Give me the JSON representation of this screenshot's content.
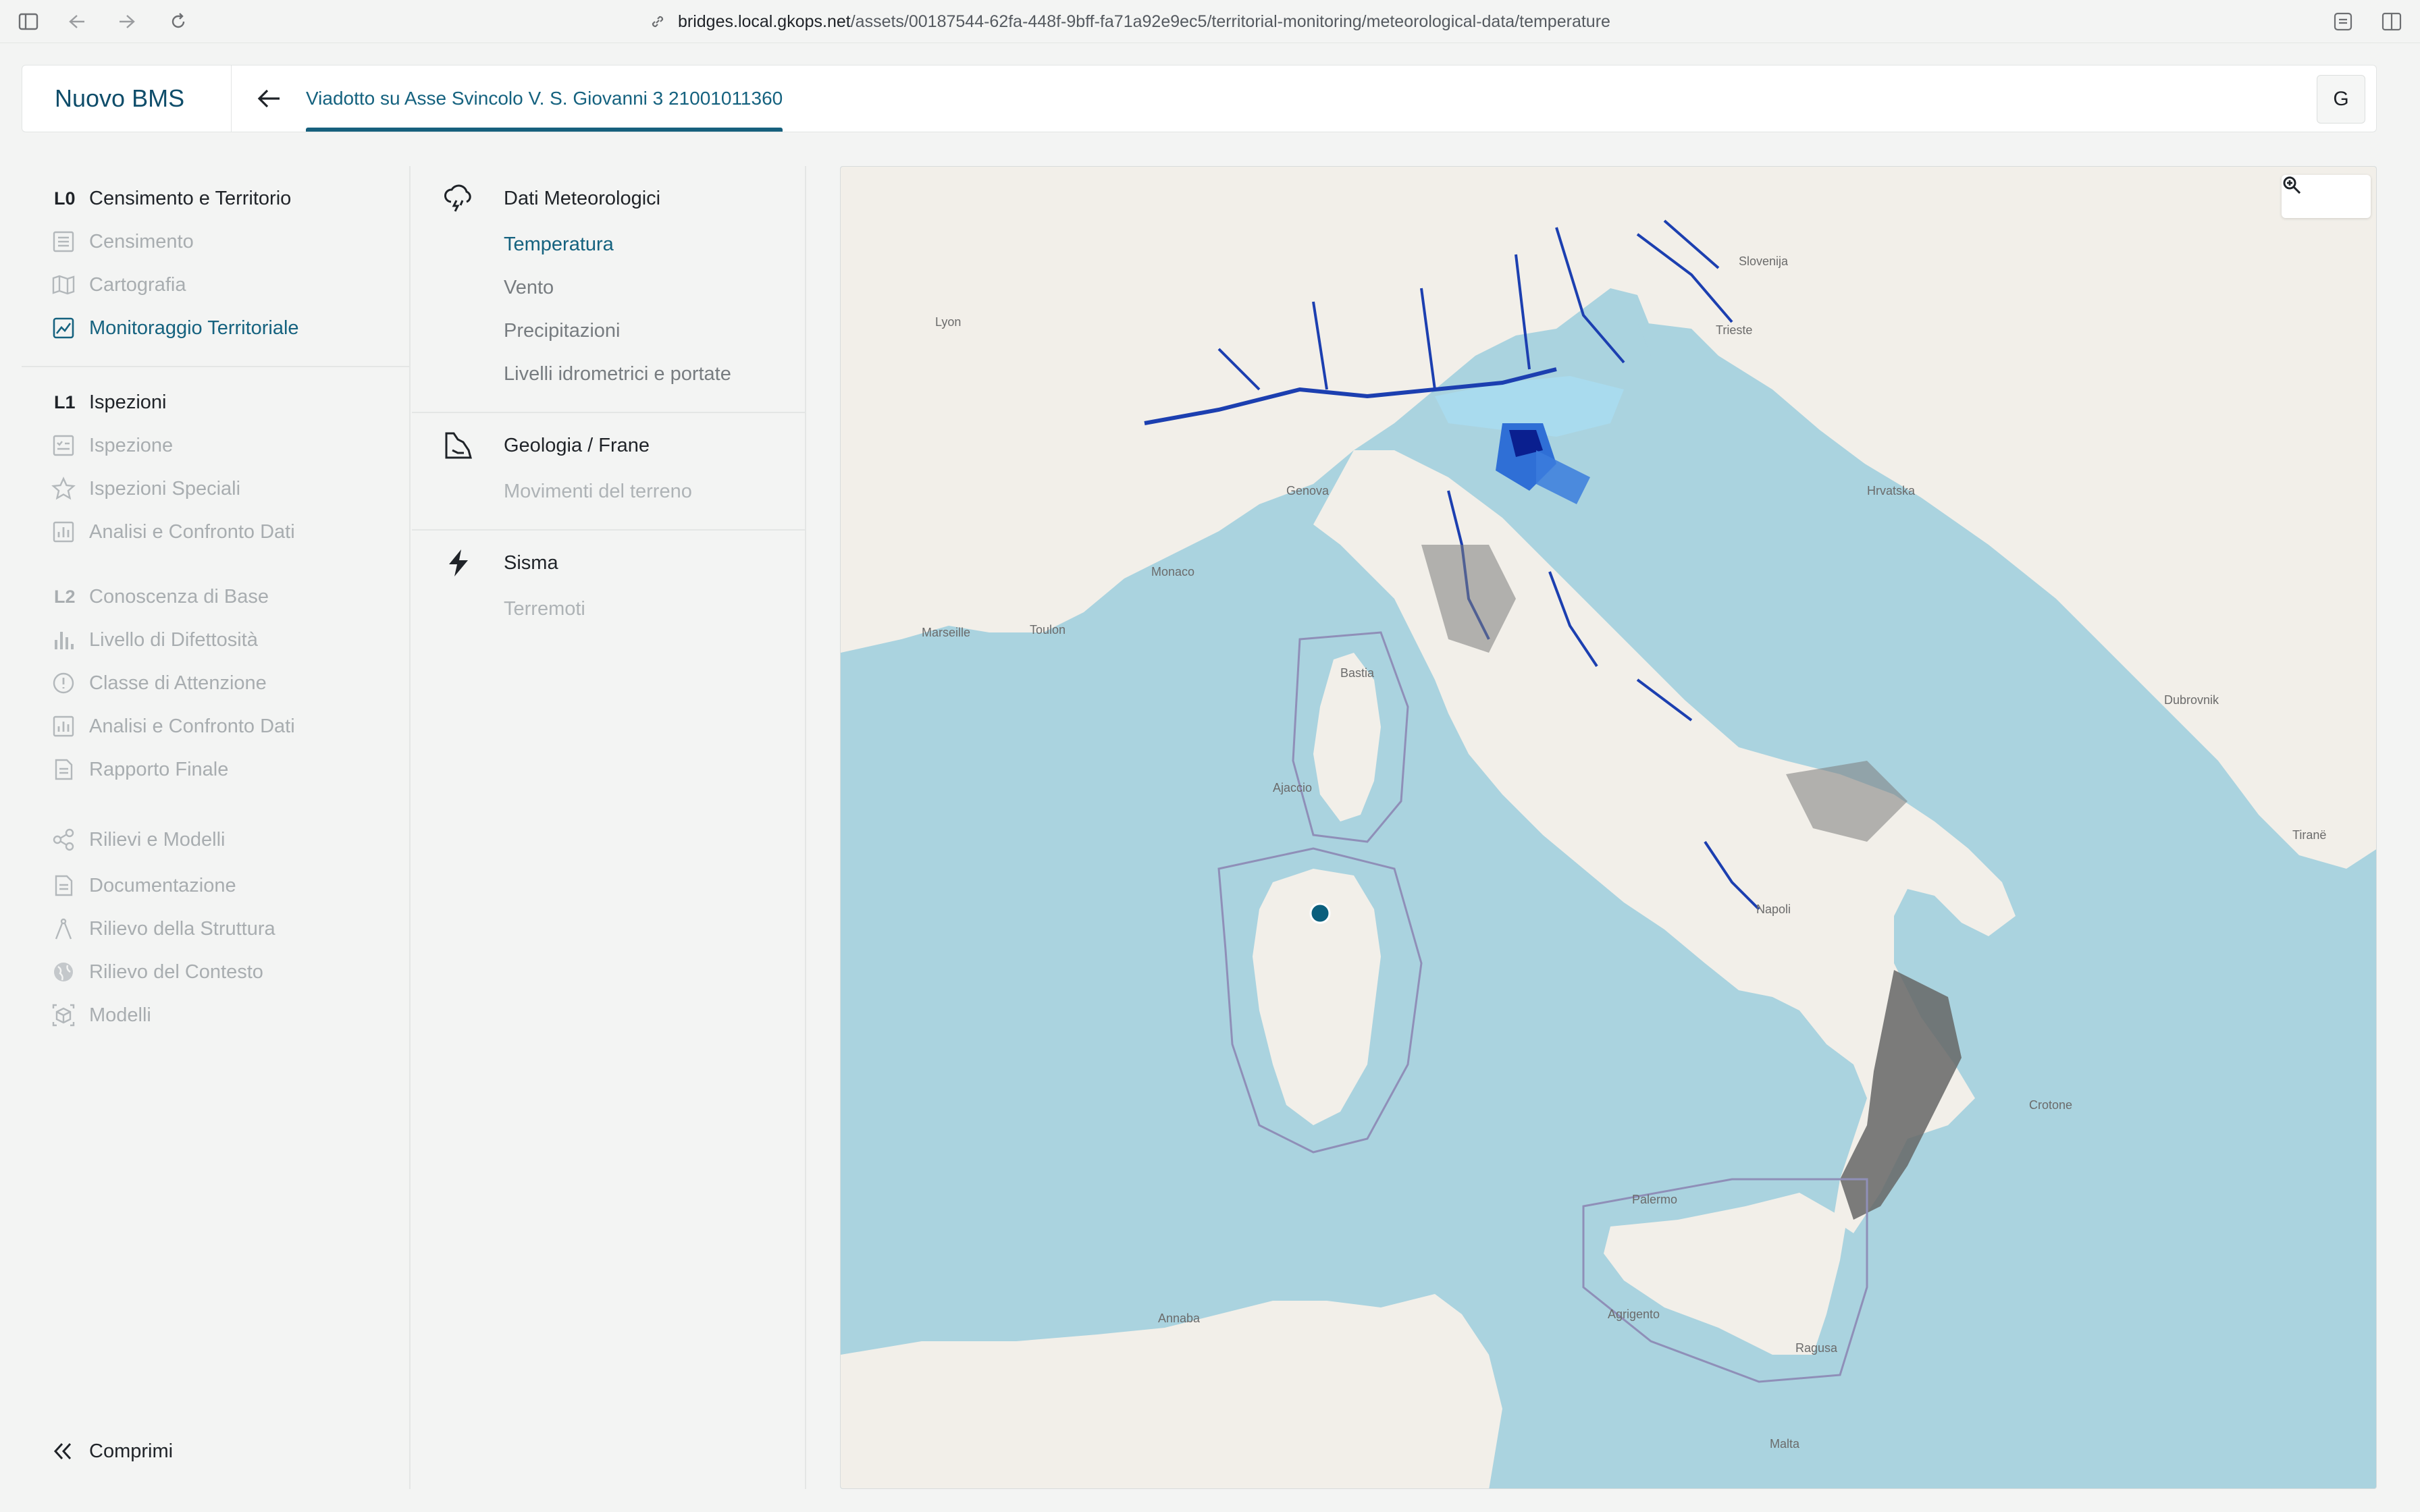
{
  "browser": {
    "url_host": "bridges.local.gkops.net",
    "url_path": "/assets/00187544-62fa-448f-9bff-fa71a92e9ec5/territorial-monitoring/meteorological-data/temperature"
  },
  "header": {
    "brand": "Nuovo BMS",
    "asset_title": "Viadotto su Asse Svincolo V. S. Giovanni 3 21001011360",
    "avatar_initial": "G"
  },
  "sidebar": {
    "sections": [
      {
        "level": "L0",
        "title": "Censimento e Territorio",
        "items": [
          {
            "label": "Censimento",
            "icon": "list-icon"
          },
          {
            "label": "Cartografia",
            "icon": "map-icon"
          },
          {
            "label": "Monitoraggio Territoriale",
            "icon": "chart-icon"
          }
        ]
      },
      {
        "level": "L1",
        "title": "Ispezioni",
        "items": [
          {
            "label": "Ispezione",
            "icon": "checklist-icon"
          },
          {
            "label": "Ispezioni Speciali",
            "icon": "star-icon"
          },
          {
            "label": "Analisi e Confronto Dati",
            "icon": "bar-chart-icon"
          }
        ]
      },
      {
        "level": "L2",
        "title": "Conoscenza di Base",
        "items": [
          {
            "label": "Livello di Difettosità",
            "icon": "bars-icon"
          },
          {
            "label": "Classe di Attenzione",
            "icon": "info-icon"
          },
          {
            "label": "Analisi e Confronto Dati",
            "icon": "bar-chart-icon"
          },
          {
            "label": "Rapporto Finale",
            "icon": "document-icon"
          }
        ]
      }
    ],
    "extra_items": [
      {
        "label": "Rilievi e Modelli",
        "icon": "share-icon"
      },
      {
        "label": "Documentazione",
        "icon": "document-icon"
      },
      {
        "label": "Rilievo della Struttura",
        "icon": "compass-icon"
      },
      {
        "label": "Rilievo del Contesto",
        "icon": "globe-icon"
      },
      {
        "label": "Modelli",
        "icon": "cube-icon"
      }
    ],
    "collapse_label": "Comprimi"
  },
  "subnav": {
    "groups": [
      {
        "title": "Dati Meteorologici",
        "icon": "storm-cloud-icon",
        "items": [
          "Temperatura",
          "Vento",
          "Precipitazioni",
          "Livelli idrometrici e portate"
        ]
      },
      {
        "title": "Geologia / Frane",
        "icon": "landslide-icon",
        "items": [
          "Movimenti del terreno"
        ]
      },
      {
        "title": "Sisma",
        "icon": "lightning-icon",
        "items": [
          "Terremoti"
        ]
      }
    ]
  },
  "map": {
    "labels": {
      "monaco": "Monaco",
      "genova": "Genova",
      "napoli": "Napoli",
      "palermo": "Palermo",
      "malta": "Malta",
      "bastia": "Bastia",
      "ajaccio": "Ajaccio",
      "crotone": "Crotone",
      "hrvatska": "Hrvatska",
      "slovenija": "Slovenija",
      "tirane": "Tiranë",
      "dubrovnik": "Dubrovnik",
      "marseille": "Marseille",
      "toulon": "Toulon",
      "lyon": "Lyon",
      "trieste": "Trieste",
      "ragusa": "Ragusa",
      "agrigento": "Agrigento",
      "annaba": "Annaba"
    },
    "colors": {
      "sea": "#aad3df",
      "land": "#f2efe9",
      "flood_light": "#a9dcf0",
      "flood_dark": "#0a1f8f",
      "bridge_marker": "#0b5f7d"
    }
  }
}
